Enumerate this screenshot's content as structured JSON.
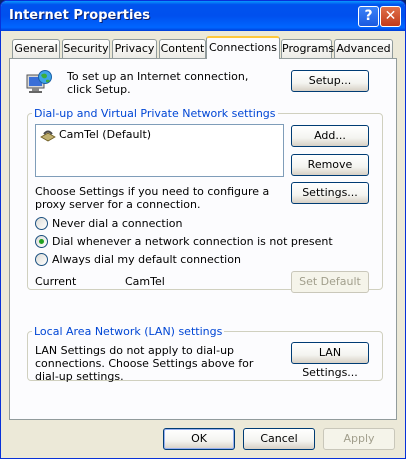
{
  "window": {
    "title": "Internet Properties",
    "help_glyph": "?",
    "close_glyph": "✕"
  },
  "tabs": [
    "General",
    "Security",
    "Privacy",
    "Content",
    "Connections",
    "Programs",
    "Advanced"
  ],
  "active_tab": "Connections",
  "setup": {
    "text": "To set up an Internet connection, click Setup.",
    "button": "Setup..."
  },
  "dialup": {
    "group_label": "Dial-up and Virtual Private Network settings",
    "items": [
      {
        "label": "CamTel (Default)",
        "selected": true
      }
    ],
    "add_button": "Add...",
    "remove_button": "Remove",
    "settings_text": "Choose Settings if you need to configure a proxy server for a connection.",
    "settings_button": "Settings...",
    "options": [
      {
        "label": "Never dial a connection",
        "checked": false
      },
      {
        "label": "Dial whenever a network connection is not present",
        "checked": true
      },
      {
        "label": "Always dial my default connection",
        "checked": false
      }
    ],
    "current_label": "Current",
    "current_value": "CamTel",
    "set_default_button": "Set Default"
  },
  "lan": {
    "group_label": "Local Area Network (LAN) settings",
    "text": "LAN Settings do not apply to dial-up connections. Choose Settings above for dial-up settings.",
    "button": "LAN Settings..."
  },
  "footer": {
    "ok": "OK",
    "cancel": "Cancel",
    "apply": "Apply"
  }
}
